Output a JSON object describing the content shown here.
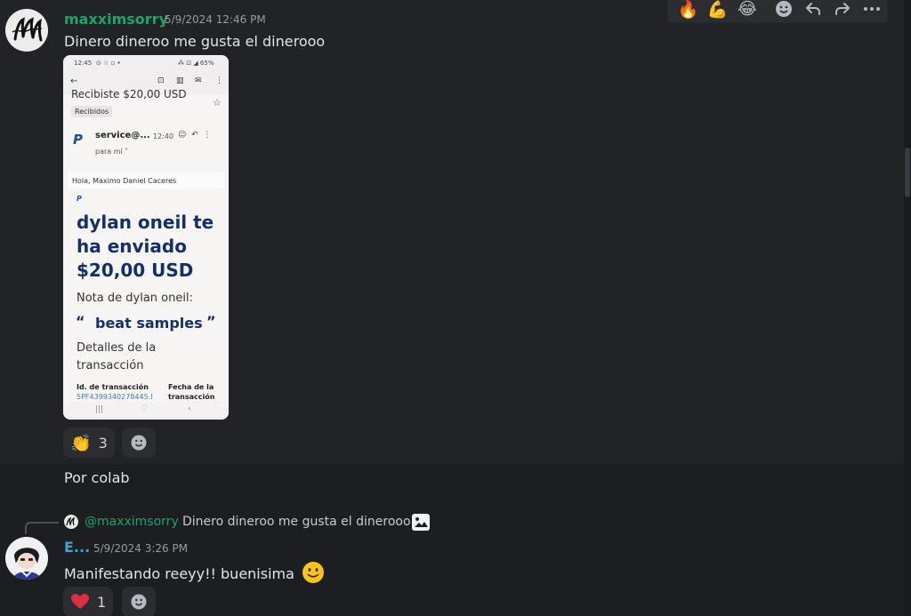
{
  "message1": {
    "username": "maxximsorry",
    "username_color": "#1fa36a",
    "timestamp": "5/9/2024 12:46 PM",
    "text": "Dinero dineroo me gusta el dinerooo",
    "attachment": {
      "status_time": "12:45",
      "status_icons": "⊙ ☆ ▫ •",
      "status_right": "⁂ ⊡ ◢ 65%",
      "subject": "Recibiste $20,00 USD",
      "label_chip": "Recibidos",
      "sender": "service@...",
      "sent_time": "12:40",
      "recipient": "para mí ˅",
      "greeting": "Hola, Maximo Daniel Caceres",
      "headline": [
        "dylan oneil te",
        "ha enviado",
        "$20,00 USD"
      ],
      "note_label": "Nota de dylan oneil:",
      "note_open": "“",
      "note_text": "beat samples",
      "note_close": "”",
      "details_label": [
        "Detalles de la",
        "transacción"
      ],
      "txn_id_label": "Id. de transacción",
      "txn_id_value": "5PF4399340278445.I",
      "txn_date_label": [
        "Fecha de la",
        "transacción"
      ]
    },
    "reaction": {
      "emoji": "👏",
      "count": "3"
    }
  },
  "message2": {
    "text": "Por colab"
  },
  "message3": {
    "reply_mention": "@maxximsorry",
    "reply_text": "Dinero dineroo me gusta el dinerooo",
    "username": "E...",
    "username_color": "#3ea6d6",
    "timestamp": "5/9/2024 3:26 PM",
    "text": "Manifestando reeyy!! buenisima",
    "reaction": {
      "emoji": "heart",
      "count": "1"
    }
  },
  "toolbar": {
    "quick_reactions": [
      "🔥",
      "💪",
      "😂"
    ],
    "icons": [
      "add-reaction-icon",
      "reply-icon",
      "forward-icon",
      "more-icon"
    ]
  }
}
